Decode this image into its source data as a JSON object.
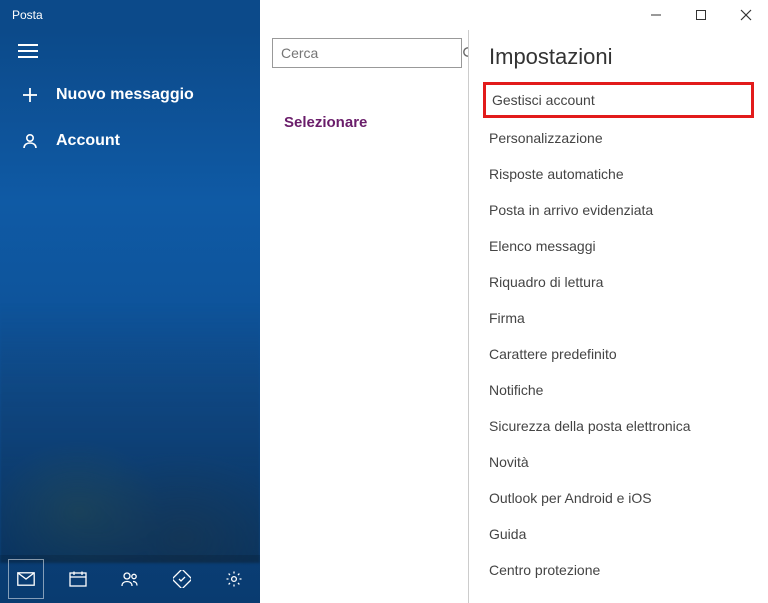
{
  "app_title": "Posta",
  "sidebar": {
    "new_message": "Nuovo messaggio",
    "account": "Account"
  },
  "main": {
    "search_placeholder": "Cerca",
    "annotation_select": "Selezionare"
  },
  "settings": {
    "title": "Impostazioni",
    "items": [
      "Gestisci account",
      "Personalizzazione",
      "Risposte automatiche",
      "Posta in arrivo evidenziata",
      "Elenco messaggi",
      "Riquadro di lettura",
      "Firma",
      "Carattere predefinito",
      "Notifiche",
      "Sicurezza della posta elettronica",
      "Novità",
      "Outlook per Android e iOS",
      "Guida",
      "Centro protezione"
    ]
  }
}
